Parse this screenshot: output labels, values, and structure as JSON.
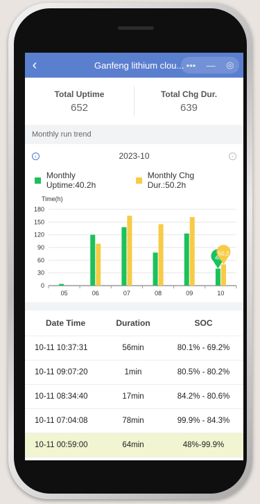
{
  "header": {
    "back_icon": "chevron-left-icon",
    "title": "Ganfeng lithium clou...",
    "capsule": [
      "•••",
      "—",
      "◎"
    ]
  },
  "totals": [
    {
      "label": "Total Uptime",
      "value": "652"
    },
    {
      "label": "Total Chg Dur.",
      "value": "639"
    }
  ],
  "section_title": "Monthly run trend",
  "month": "2023-10",
  "legend": [
    {
      "label": "Monthly Uptime:40.2h",
      "color": "#1cc15a"
    },
    {
      "label": "Monthly Chg Dur.:50.2h",
      "color": "#f7cb45"
    }
  ],
  "chart_data": {
    "type": "bar",
    "ylabel": "Time(h)",
    "categories": [
      "05",
      "06",
      "07",
      "08",
      "09",
      "10"
    ],
    "yticks": [
      0,
      30,
      60,
      90,
      120,
      150,
      180
    ],
    "ylim": [
      0,
      180
    ],
    "series": [
      {
        "name": "Monthly Uptime",
        "color": "#1cc15a",
        "values": [
          4,
          120,
          138,
          78,
          123,
          40.2
        ]
      },
      {
        "name": "Monthly Chg Dur.",
        "color": "#f7cb45",
        "values": [
          0,
          99,
          165,
          145,
          162,
          50.2
        ]
      }
    ],
    "markers": [
      {
        "series": 0,
        "index": 5,
        "label": "40"
      },
      {
        "series": 1,
        "index": 5,
        "label": "50.2"
      }
    ]
  },
  "table": {
    "headers": [
      "Date Time",
      "Duration",
      "SOC"
    ],
    "rows": [
      [
        "10-11 10:37:31",
        "56min",
        "80.1% - 69.2%"
      ],
      [
        "10-11 09:07:20",
        "1min",
        "80.5% - 80.2%"
      ],
      [
        "10-11 08:34:40",
        "17min",
        "84.2% - 80.6%"
      ],
      [
        "10-11 07:04:08",
        "78min",
        "99.9% - 84.3%"
      ],
      [
        "10-11 00:59:00",
        "64min",
        "48%-99.9%"
      ]
    ]
  }
}
